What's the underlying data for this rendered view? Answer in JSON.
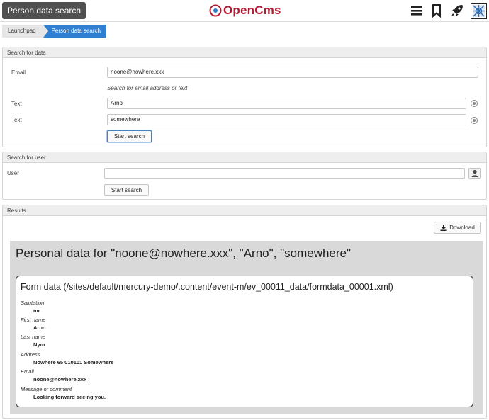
{
  "header": {
    "app_title": "Person data search",
    "logo_text": "OpenCms",
    "brand_color": "#b31b34"
  },
  "breadcrumb": {
    "items": [
      "Launchpad",
      "Person data search"
    ]
  },
  "search_data": {
    "title": "Search for data",
    "email_label": "Email",
    "email_value": "noone@nowhere.xxx",
    "hint": "Search for email address or text",
    "text1_label": "Text",
    "text1_value": "Arno",
    "text2_label": "Text",
    "text2_value": "somewhere",
    "button": "Start search"
  },
  "search_user": {
    "title": "Search for user",
    "user_label": "User",
    "user_value": "",
    "button": "Start search"
  },
  "results": {
    "title": "Results",
    "download": "Download",
    "report_title": "Personal data for \"noone@nowhere.xxx\", \"Arno\", \"somewhere\"",
    "form_title": "Form data (/sites/default/mercury-demo/.content/event-m/ev_00011_data/formdata_00001.xml)",
    "fields": [
      {
        "label": "Salutation",
        "value": "mr"
      },
      {
        "label": "First name",
        "value": "Arno"
      },
      {
        "label": "Last name",
        "value": "Nym"
      },
      {
        "label": "Address",
        "value": "Nowhere 65 010101 Somewhere"
      },
      {
        "label": "Email",
        "value": "noone@nowhere.xxx"
      },
      {
        "label": "Message or comment",
        "value": "Looking forward seeing you."
      }
    ]
  }
}
